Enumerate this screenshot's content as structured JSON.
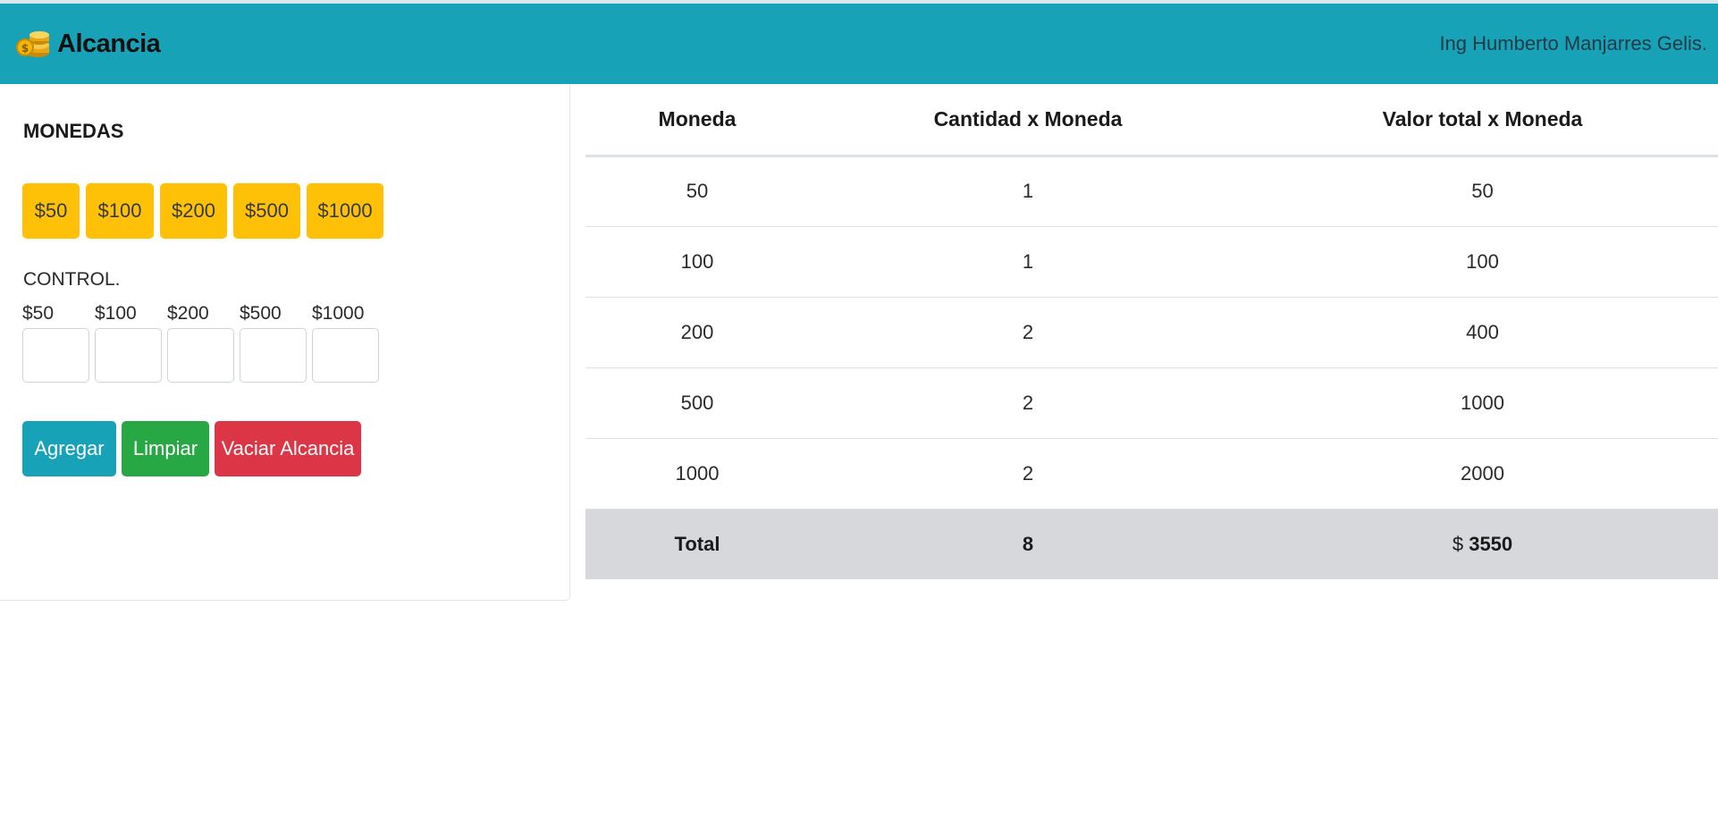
{
  "navbar": {
    "brand": "Alcancia",
    "author": "Ing Humberto Manjarres Gelis."
  },
  "coins": {
    "title": "MONEDAS",
    "buttons": [
      "$50",
      "$100",
      "$200",
      "$500",
      "$1000"
    ]
  },
  "control": {
    "title": "CONTROL.",
    "labels": [
      "$50",
      "$100",
      "$200",
      "$500",
      "$1000"
    ],
    "values": [
      "",
      "",
      "",
      "",
      ""
    ]
  },
  "actions": {
    "add": "Agregar",
    "clear": "Limpiar",
    "empty": "Vaciar Alcancia"
  },
  "colors": {
    "navbar": "#17a2b8",
    "coin_button": "#ffc107",
    "add_button": "#17a2b8",
    "clear_button": "#28a745",
    "empty_button": "#dc3545",
    "total_row": "#d6d8db"
  },
  "table": {
    "headers": [
      "Moneda",
      "Cantidad x Moneda",
      "Valor total x Moneda"
    ],
    "rows": [
      [
        "50",
        "1",
        "50"
      ],
      [
        "100",
        "1",
        "100"
      ],
      [
        "200",
        "2",
        "400"
      ],
      [
        "500",
        "2",
        "1000"
      ],
      [
        "1000",
        "2",
        "2000"
      ]
    ],
    "total": {
      "label": "Total",
      "count": "8",
      "currency": "$",
      "value": "3550"
    }
  }
}
